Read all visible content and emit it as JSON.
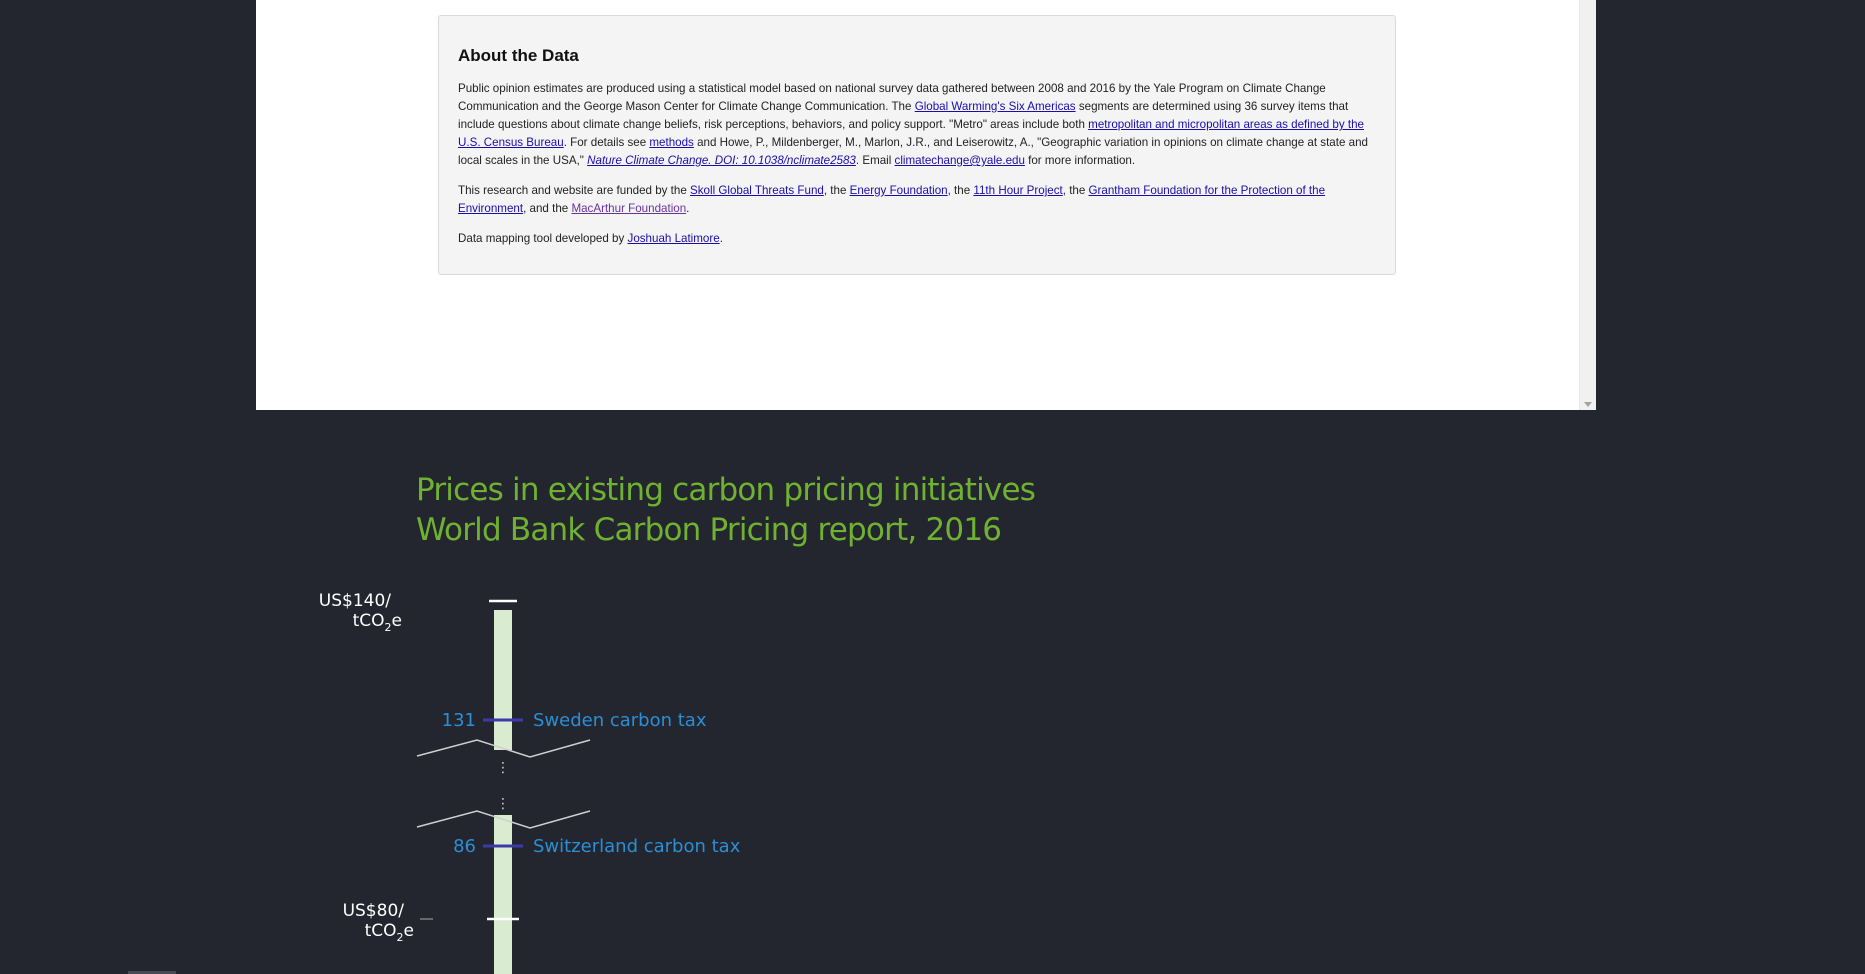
{
  "about": {
    "heading": "About the Data",
    "p1": {
      "t1": "Public opinion estimates are produced using a statistical model based on national survey data gathered between 2008 and 2016 by the Yale Program on Climate Change Communication and the George Mason Center for Climate Change Communication. The ",
      "link1": "Global Warming's Six Americas",
      "t2": " segments are determined using 36 survey items that include questions about climate change beliefs, risk perceptions, behaviors, and policy support. \"Metro\" areas include both ",
      "link2": "metropolitan and micropolitan areas as defined by the U.S. Census Bureau",
      "t3": ". For details see ",
      "link3": "methods",
      "t4": " and Howe, P., Mildenberger, M., Marlon, J.R., and Leiserowitz, A., \"Geographic variation in opinions on climate change at state and local scales in the USA,\" ",
      "link4": "Nature Climate Change. DOI: 10.1038/nclimate2583",
      "t5": ". Email ",
      "link5": "climatechange@yale.edu",
      "t6": " for more information."
    },
    "p2": {
      "t1": "This research and website are funded by the ",
      "link1": "Skoll Global Threats Fund",
      "t2": ", the ",
      "link2": "Energy Foundation",
      "t3": ", the ",
      "link3": "11th Hour Project",
      "t4": ", the ",
      "link4": "Grantham Foundation for the Protection of the Environment",
      "t5": ", and the ",
      "link5": "MacArthur Foundation",
      "t6": "."
    },
    "p3": {
      "t1": "Data mapping tool developed by ",
      "link1": "Joshuah Latimore",
      "t2": "."
    }
  },
  "infographic": {
    "title_line1": "Prices in existing carbon pricing initiatives",
    "title_line2": "World Bank Carbon Pricing report, 2016",
    "axis_top": {
      "line1": "US$140/",
      "line2_main": "tCO",
      "line2_sub": "2",
      "line2_end": "e"
    },
    "axis_bottom": {
      "line1": "US$80/",
      "line2_main": "tCO",
      "line2_sub": "2",
      "line2_end": "e"
    },
    "ellipsis": "⋮",
    "colors": {
      "title": "#6fb130",
      "bar": "#d9ecd0",
      "value": "#2a8fd6",
      "tick": "#3a3aa8",
      "break_line": "#cfcfcf",
      "axis_text": "#ffffff"
    }
  },
  "chart_data": {
    "type": "bar",
    "title": "Prices in existing carbon pricing initiatives",
    "subtitle": "World Bank Carbon Pricing report, 2016",
    "axis_labels": [
      "US$140/tCO2e",
      "US$80/tCO2e"
    ],
    "axis_ticks": [
      140,
      80
    ],
    "axis_break": true,
    "points": [
      {
        "value": 131,
        "label": "Sweden carbon tax"
      },
      {
        "value": 86,
        "label": "Switzerland carbon tax"
      }
    ]
  }
}
